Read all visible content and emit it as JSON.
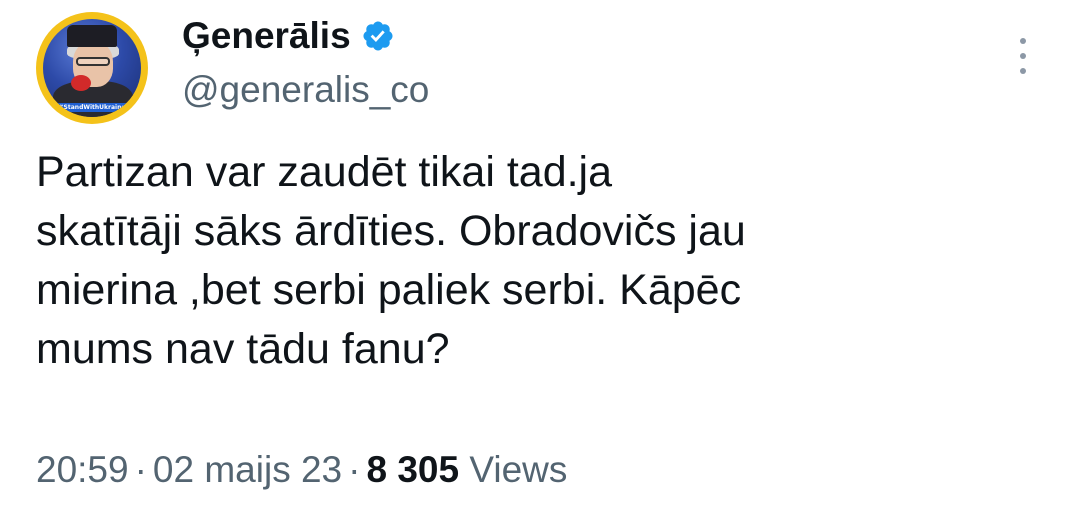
{
  "author": {
    "display_name": "Ģenerālis",
    "handle": "@generalis_co",
    "verified": true,
    "avatar_badge_text": "#StandWithUkraine",
    "avatar_ring_color": "#f4c21a"
  },
  "tweet": {
    "text": "Partizan var zaudēt tikai tad.ja\nskatītāji sāks ārdīties. Obradovičs jau\nmierina ,bet serbi paliek serbi. Kāpēc\nmums nav tādu fanu?",
    "time": "20:59",
    "separator": "·",
    "date": "02 maijs 23",
    "views_count": "8 305",
    "views_label": "Views"
  },
  "icons": {
    "verified": "verified-badge-icon",
    "more": "more-vertical-icon"
  },
  "colors": {
    "verified_blue": "#1d9bf0",
    "text_primary": "#0f1419",
    "text_secondary": "#536471"
  }
}
